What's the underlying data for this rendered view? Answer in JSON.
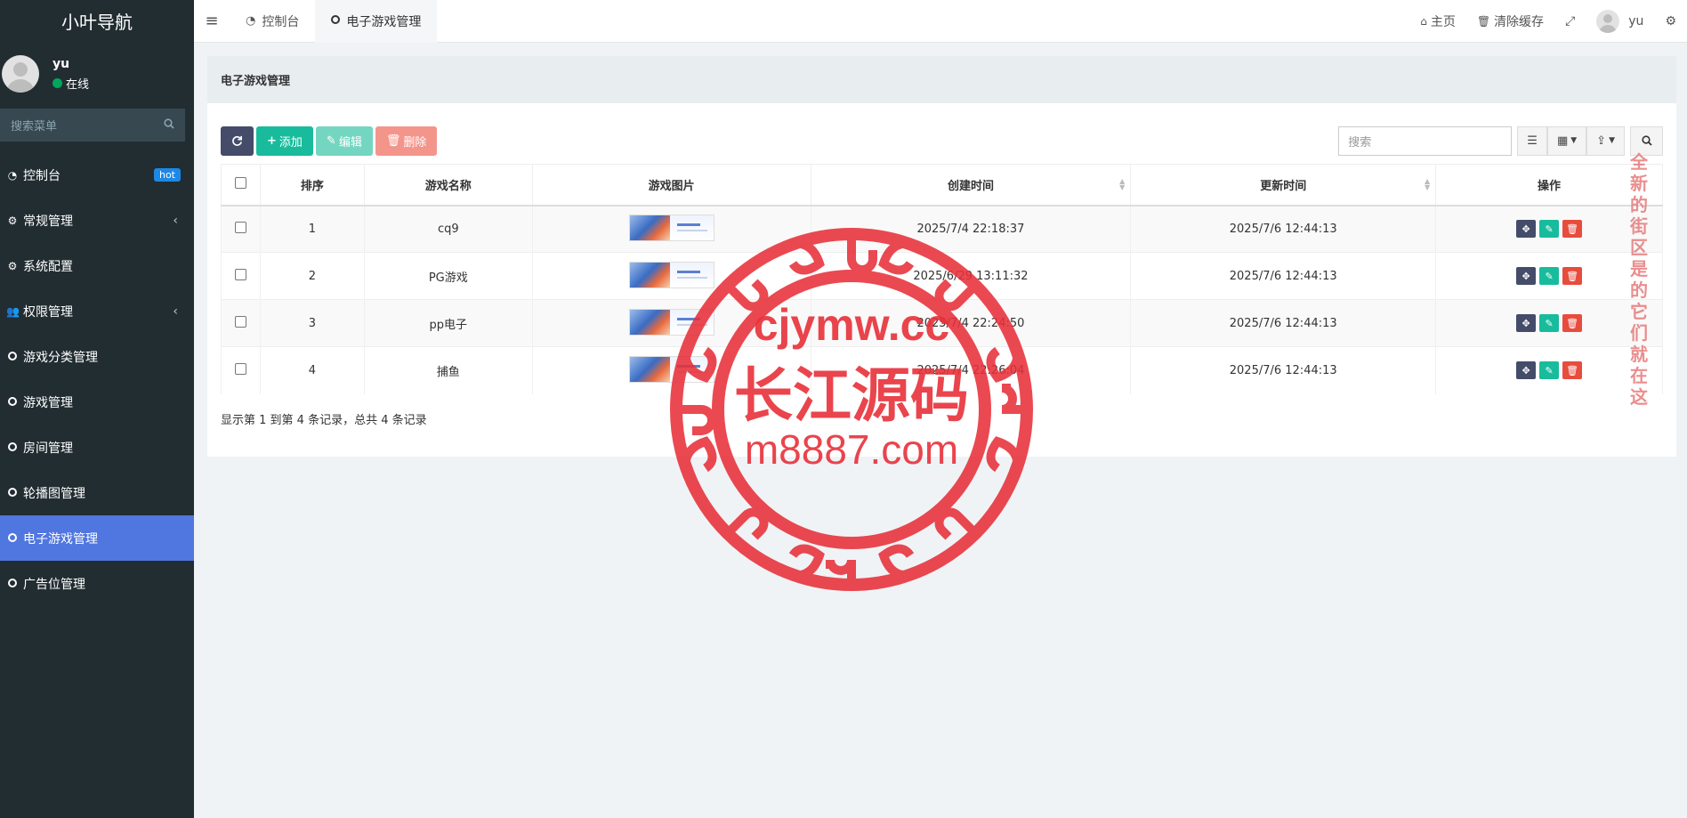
{
  "sidebar": {
    "brand": "小叶导航",
    "user": {
      "name": "yu",
      "status": "在线"
    },
    "search_placeholder": "搜索菜单",
    "items": [
      {
        "label": "控制台",
        "icon": "dashboard-icon",
        "badge": "hot"
      },
      {
        "label": "常规管理",
        "icon": "cogs-icon",
        "has_arrow": true
      },
      {
        "label": "系统配置",
        "icon": "gear-icon"
      },
      {
        "label": "权限管理",
        "icon": "users-icon",
        "has_arrow": true
      },
      {
        "label": "游戏分类管理",
        "icon": "circle-icon"
      },
      {
        "label": "游戏管理",
        "icon": "circle-icon"
      },
      {
        "label": "房间管理",
        "icon": "circle-icon"
      },
      {
        "label": "轮播图管理",
        "icon": "circle-icon"
      },
      {
        "label": "电子游戏管理",
        "icon": "circle-icon",
        "active": true
      },
      {
        "label": "广告位管理",
        "icon": "circle-icon"
      }
    ],
    "active_color": "#5076e0"
  },
  "topbar": {
    "tabs": [
      {
        "label": "控制台",
        "icon": "dashboard-icon"
      },
      {
        "label": "电子游戏管理",
        "icon": "circle-icon",
        "active": true
      }
    ],
    "home_label": "主页",
    "clear_cache_label": "清除缓存",
    "user_name": "yu"
  },
  "panel": {
    "title": "电子游戏管理",
    "toolbar": {
      "add_label": "添加",
      "edit_label": "编辑",
      "delete_label": "删除",
      "search_placeholder": "搜索"
    },
    "table": {
      "columns": [
        "排序",
        "游戏名称",
        "游戏图片",
        "创建时间",
        "更新时间",
        "操作"
      ],
      "rows": [
        {
          "order": "1",
          "name": "cq9",
          "created": "2025/7/4 22:18:37",
          "updated": "2025/7/6 12:44:13"
        },
        {
          "order": "2",
          "name": "PG游戏",
          "created": "2025/6/29 13:11:32",
          "updated": "2025/7/6 12:44:13"
        },
        {
          "order": "3",
          "name": "pp电子",
          "created": "2025/7/4 22:24:50",
          "updated": "2025/7/6 12:44:13"
        },
        {
          "order": "4",
          "name": "捕鱼",
          "created": "2025/7/4 22:26:04",
          "updated": "2025/7/6 12:44:13"
        }
      ]
    },
    "pager": "显示第 1 到第 4 条记录，总共 4 条记录"
  },
  "watermark": {
    "line1": "cjymw.cc",
    "line2": "长江源码",
    "line3": "m8887.com",
    "side_text": "全新的街区 是的 它们就在这",
    "color": "#e8303a"
  }
}
